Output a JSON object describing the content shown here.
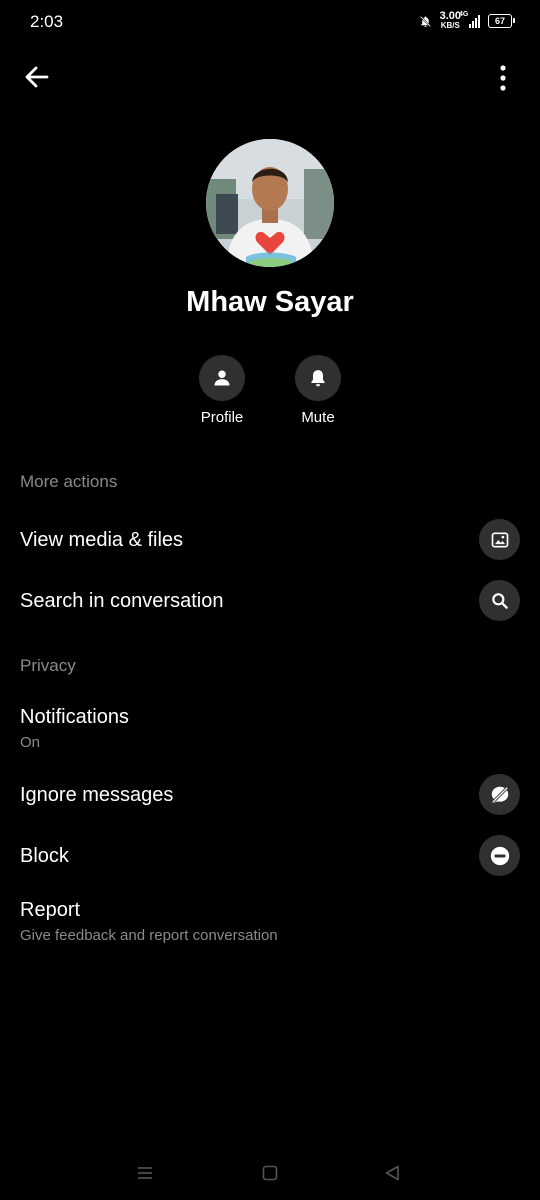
{
  "status_bar": {
    "time": "2:03",
    "net_speed_value": "3.00",
    "net_speed_unit": "KB/S",
    "network_type": "4G",
    "battery": "67"
  },
  "contact": {
    "name": "Mhaw Sayar"
  },
  "quick_actions": [
    {
      "label": "Profile",
      "icon": "person-icon"
    },
    {
      "label": "Mute",
      "icon": "bell-icon"
    }
  ],
  "sections": {
    "more_actions": "More actions",
    "privacy": "Privacy"
  },
  "rows": {
    "view_media": {
      "title": "View media & files",
      "icon": "image-icon"
    },
    "search": {
      "title": "Search in conversation",
      "icon": "search-icon"
    },
    "notifications": {
      "title": "Notifications",
      "sub": "On"
    },
    "ignore": {
      "title": "Ignore messages",
      "icon": "ignore-icon"
    },
    "block": {
      "title": "Block",
      "icon": "block-icon"
    },
    "report": {
      "title": "Report",
      "sub": "Give feedback and report conversation"
    }
  },
  "colors": {
    "background": "#000000",
    "icon_circle": "#303030",
    "secondary_text": "#8a8a8a"
  }
}
